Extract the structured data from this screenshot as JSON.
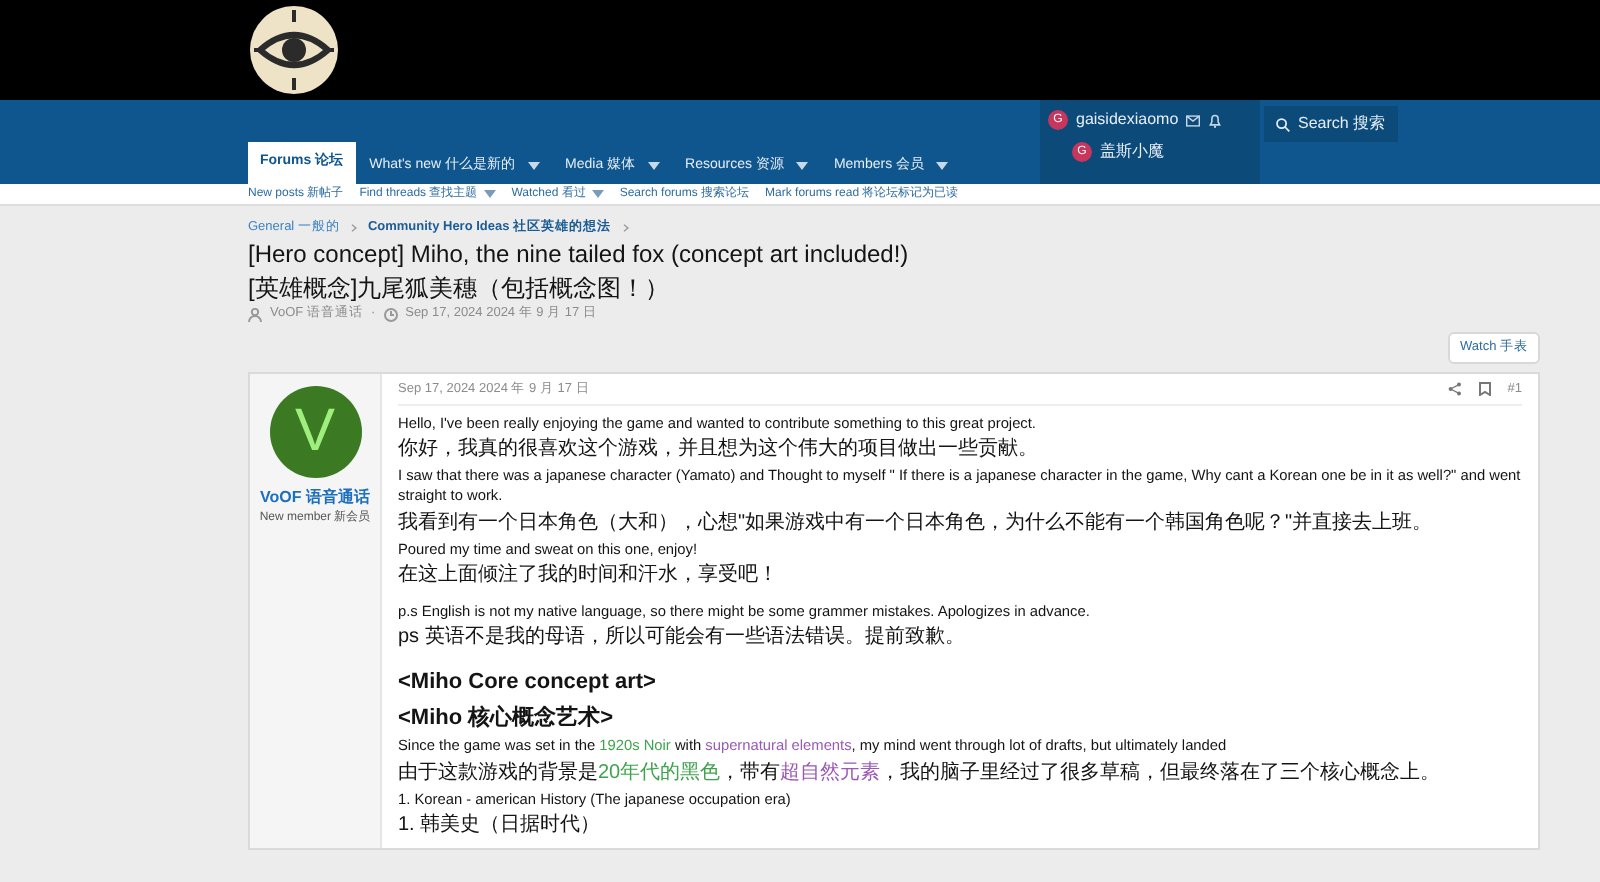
{
  "header": {
    "user": {
      "name": "gaisidexiaomo",
      "name_alt": "盖斯小魔",
      "avatar_letter": "G",
      "avatar_letter_alt": "G"
    },
    "search": "Search  搜索"
  },
  "nav": [
    {
      "label": "Forums  论坛",
      "selected": true,
      "dropdown": false
    },
    {
      "label": "What's new  什么是新的",
      "selected": false,
      "dropdown": true
    },
    {
      "label": "Media  媒体",
      "selected": false,
      "dropdown": true
    },
    {
      "label": "Resources  资源",
      "selected": false,
      "dropdown": true
    },
    {
      "label": "Members  会员",
      "selected": false,
      "dropdown": true
    }
  ],
  "subnav": [
    {
      "label": "New posts  新帖子",
      "dropdown": false
    },
    {
      "label": "Find threads  查找主题",
      "dropdown": true
    },
    {
      "label": "Watched  看过",
      "dropdown": true
    },
    {
      "label": "Search forums  搜索论坛",
      "dropdown": false
    },
    {
      "label": "Mark forums read  将论坛标记为已读",
      "dropdown": false
    }
  ],
  "breadcrumb": [
    {
      "label": "General  一般的",
      "bold": false
    },
    {
      "label": "Community Hero Ideas  社区英雄的想法",
      "bold": true
    }
  ],
  "thread": {
    "title": "[Hero concept] Miho, the nine tailed fox (concept art included!)",
    "title_alt": "[英雄概念]九尾狐美穗（包括概念图！）",
    "author": "VoOF  语音通话",
    "separator": "·",
    "date": "Sep 17, 2024  2024 年 9 月 17 日"
  },
  "watch_button": "Watch  手表",
  "post": {
    "author": "VoOF  语音通话",
    "avatar_letter": "V",
    "role": "New member  新会员",
    "date": "Sep 17, 2024  2024 年 9 月 17 日",
    "number": "#1",
    "body": [
      {
        "kind": "text",
        "segments": [
          {
            "text": "Hello, I've been really enjoying the game and wanted to contribute something to this great project."
          }
        ]
      },
      {
        "kind": "text",
        "segments": [
          {
            "text": "你好，我真的很喜欢这个游戏，并且想为这个伟大的项目做出一些贡献。"
          }
        ]
      },
      {
        "kind": "text",
        "segments": [
          {
            "text": "I saw that there was a japanese character (Yamato) and Thought to myself \" If there is a japanese character in the game, Why cant a Korean one be in it as well?\" and went straight to work."
          }
        ]
      },
      {
        "kind": "text",
        "segments": [
          {
            "text": "我看到有一个日本角色（大和），心想\"如果游戏中有一个日本角色，为什么不能有一个韩国角色呢？\"并直接去上班。"
          }
        ]
      },
      {
        "kind": "text",
        "segments": [
          {
            "text": "Poured my time and sweat on this one, enjoy!"
          }
        ]
      },
      {
        "kind": "text",
        "segments": [
          {
            "text": "在这上面倾注了我的时间和汗水，享受吧！"
          }
        ]
      },
      {
        "kind": "spacer"
      },
      {
        "kind": "text",
        "segments": [
          {
            "text": "p.s English is not my native language, so there might be some grammer mistakes. Apologizes in advance."
          }
        ]
      },
      {
        "kind": "text",
        "segments": [
          {
            "text": "ps 英语不是我的母语，所以可能会有一些语法错误。提前致歉。"
          }
        ]
      },
      {
        "kind": "spacer"
      },
      {
        "kind": "heading",
        "segments": [
          {
            "text": "<Miho Core concept art>"
          }
        ]
      },
      {
        "kind": "heading",
        "segments": [
          {
            "text": "<Miho 核心概念艺术>"
          }
        ]
      },
      {
        "kind": "text",
        "segments": [
          {
            "text": "Since the game was set in the "
          },
          {
            "text": "1920s Noir",
            "color": "#3fa34d"
          },
          {
            "text": " with "
          },
          {
            "text": "supernatural elements",
            "color": "#9b59b6"
          },
          {
            "text": ", my mind went through lot of drafts, but ultimately landed"
          }
        ]
      },
      {
        "kind": "text",
        "segments": [
          {
            "text": "由于这款游戏的背景是"
          },
          {
            "text": "20年代的黑色",
            "color": "#3fa34d"
          },
          {
            "text": "，带有"
          },
          {
            "text": "超自然元素",
            "color": "#9b59b6"
          },
          {
            "text": "，我的脑子里经过了很多草稿，但最终落在了三个核心概念上。"
          }
        ]
      },
      {
        "kind": "text",
        "segments": [
          {
            "text": "1. Korean - american History (The japanese occupation era)"
          }
        ]
      },
      {
        "kind": "text",
        "segments": [
          {
            "text": "1. 韩美史（日据时代）"
          }
        ]
      }
    ]
  }
}
